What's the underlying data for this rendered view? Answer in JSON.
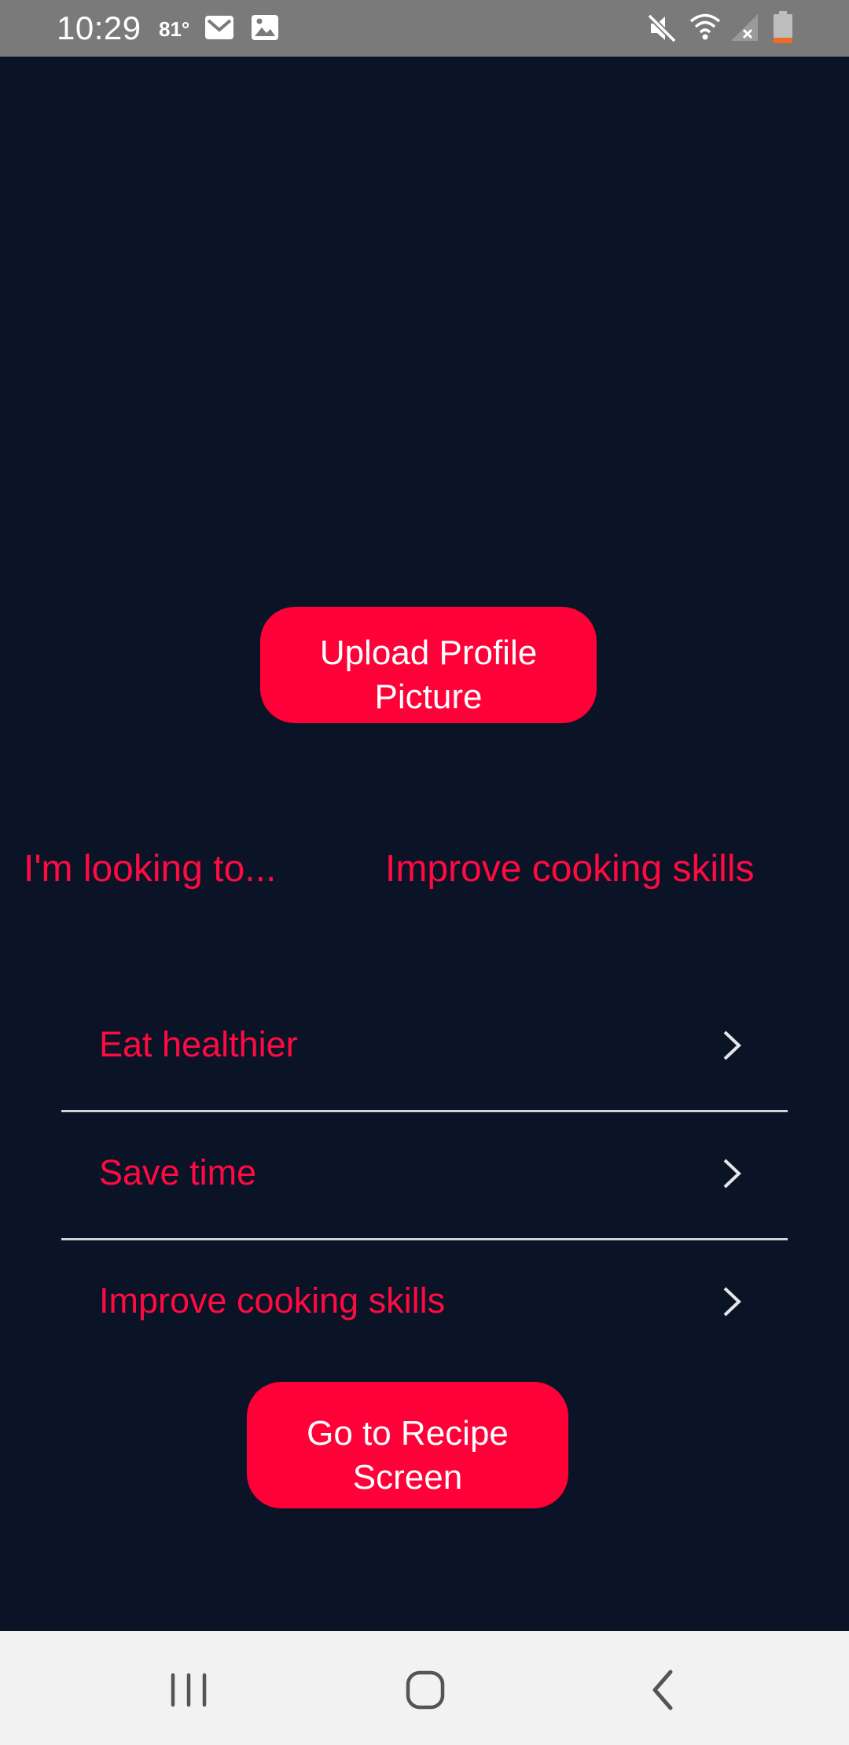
{
  "status_bar": {
    "time": "10:29",
    "temperature": "81°",
    "icons": [
      "mail-icon",
      "image-icon",
      "mute-icon",
      "wifi-icon",
      "signal-icon",
      "battery-icon"
    ]
  },
  "main": {
    "upload_button": "Upload Profile Picture",
    "looking_label": "I'm looking to...",
    "selected_goal": "Improve cooking skills",
    "goals": [
      {
        "label": "Eat healthier"
      },
      {
        "label": "Save time"
      },
      {
        "label": "Improve cooking skills"
      }
    ],
    "recipe_button": "Go to Recipe Screen"
  },
  "nav_bar": {
    "buttons": [
      "recent-apps-icon",
      "home-icon",
      "back-icon"
    ]
  },
  "colors": {
    "background": "#0b1426",
    "accent": "#ff0038",
    "accent_text": "#ff0a42",
    "divider": "#cfd3da",
    "status_bar": "#7a7a7a",
    "nav_bar": "#f2f2f2"
  }
}
